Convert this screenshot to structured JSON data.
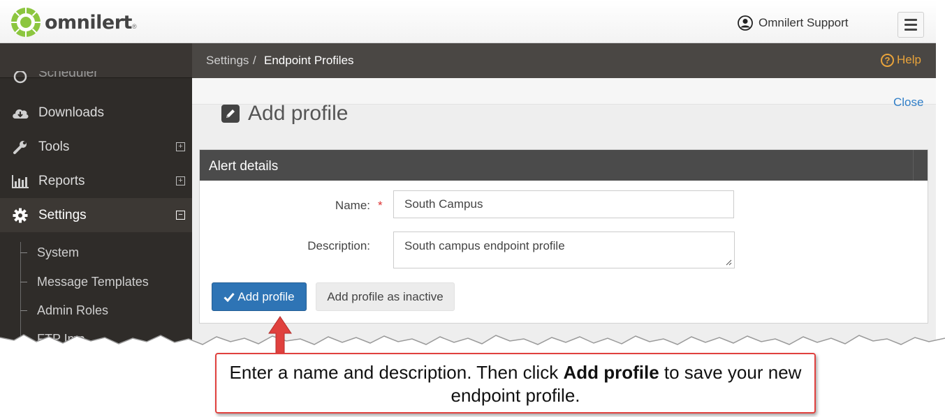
{
  "header": {
    "logo_text": "omnilert",
    "logo_reg": "®",
    "user_name": "Omnilert Support"
  },
  "sidebar": {
    "partial_item": "Scheduler",
    "items": [
      {
        "label": "Downloads",
        "icon": "cloud-download-icon",
        "toggle": ""
      },
      {
        "label": "Tools",
        "icon": "wrench-icon",
        "toggle": "+"
      },
      {
        "label": "Reports",
        "icon": "bar-chart-icon",
        "toggle": "+"
      },
      {
        "label": "Settings",
        "icon": "gear-icon",
        "toggle": "−"
      }
    ],
    "sub_items": [
      "System",
      "Message Templates",
      "Admin Roles",
      "FTP Imp..."
    ]
  },
  "breadcrumb": {
    "parent": "Settings",
    "separator": "/",
    "current": "Endpoint Profiles",
    "help_label": "Help",
    "help_glyph": "?"
  },
  "main": {
    "page_title": "Add profile",
    "close_label": "Close"
  },
  "form": {
    "panel_title": "Alert details",
    "name_label": "Name:",
    "required_mark": "*",
    "name_value": "South Campus",
    "description_label": "Description:",
    "description_value": "South campus endpoint profile",
    "add_button": "Add profile",
    "add_inactive_button": "Add profile as inactive"
  },
  "callout": {
    "text_before": "Enter a name and description. Then click ",
    "text_bold": "Add profile",
    "text_after": " to save your new endpoint profile."
  },
  "colors": {
    "brand_green": "#8cc63f",
    "primary_button": "#2e74b5",
    "help_orange": "#e8a33b",
    "callout_border": "#e0413e"
  }
}
